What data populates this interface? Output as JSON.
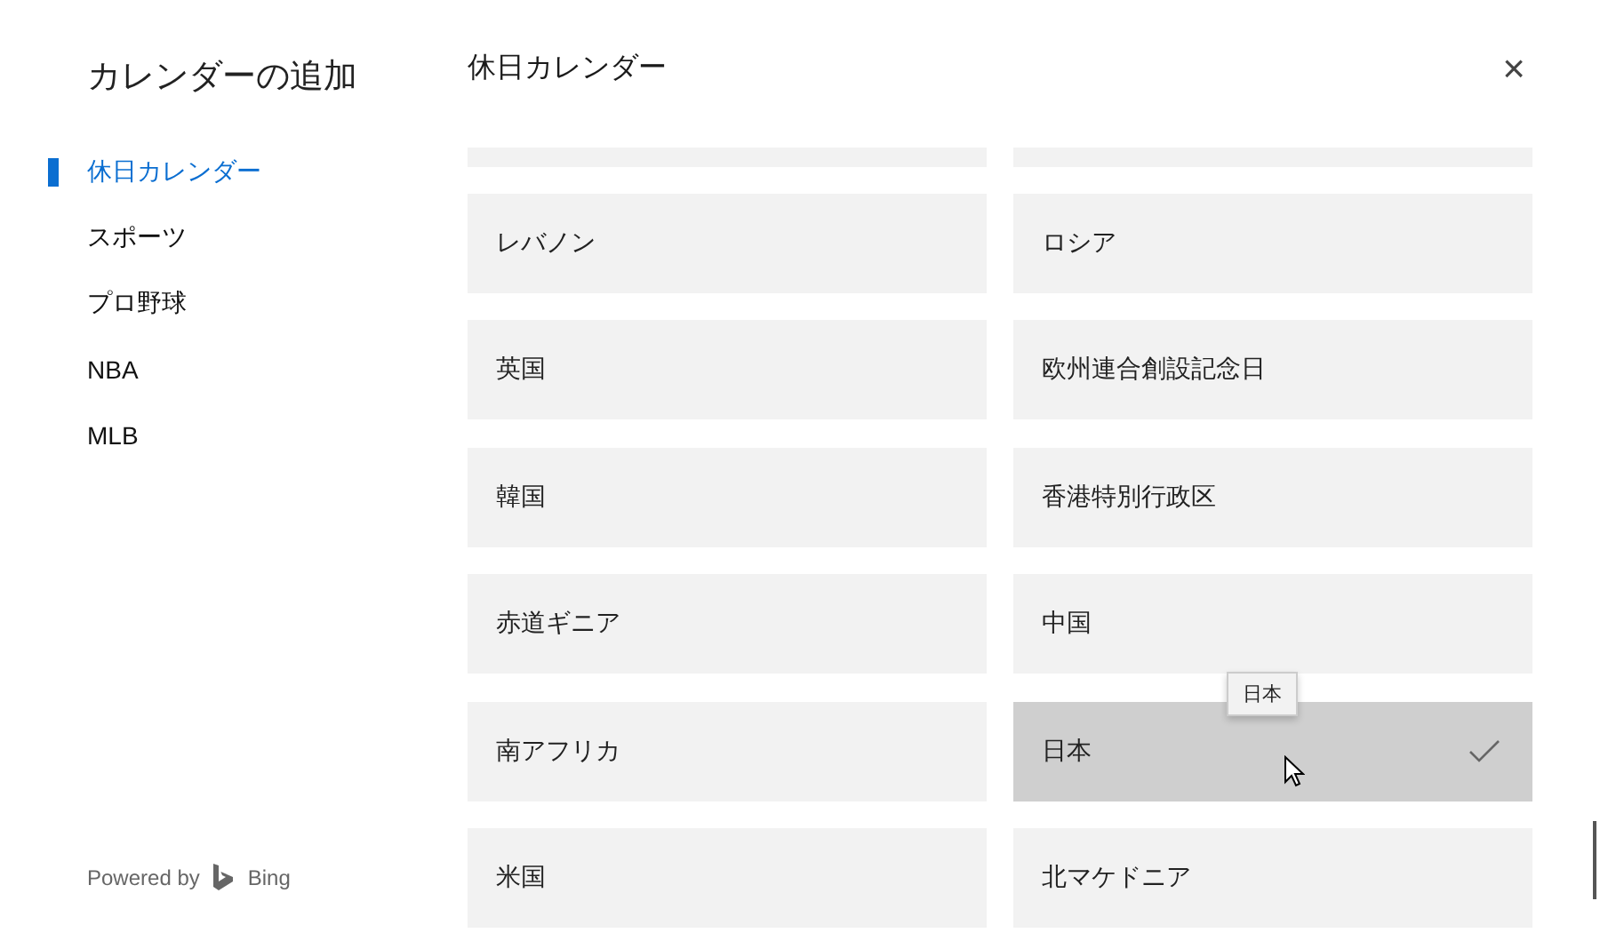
{
  "sidebar": {
    "title": "カレンダーの追加",
    "items": [
      {
        "label": "休日カレンダー",
        "selected": true
      },
      {
        "label": "スポーツ",
        "selected": false
      },
      {
        "label": "プロ野球",
        "selected": false
      },
      {
        "label": "NBA",
        "selected": false
      },
      {
        "label": "MLB",
        "selected": false
      }
    ],
    "footer": {
      "text": "Powered by",
      "brand": "Bing"
    }
  },
  "main": {
    "title": "休日カレンダー",
    "close": "×",
    "tooltip": "日本",
    "calendars": [
      {
        "label": "レバノン",
        "selected": false
      },
      {
        "label": "ロシア",
        "selected": false
      },
      {
        "label": "英国",
        "selected": false
      },
      {
        "label": "欧州連合創設記念日",
        "selected": false
      },
      {
        "label": "韓国",
        "selected": false
      },
      {
        "label": "香港特別行政区",
        "selected": false
      },
      {
        "label": "赤道ギニア",
        "selected": false
      },
      {
        "label": "中国",
        "selected": false
      },
      {
        "label": "南アフリカ",
        "selected": false
      },
      {
        "label": "日本",
        "selected": true
      },
      {
        "label": "米国",
        "selected": false
      },
      {
        "label": "北マケドニア",
        "selected": false
      }
    ]
  }
}
